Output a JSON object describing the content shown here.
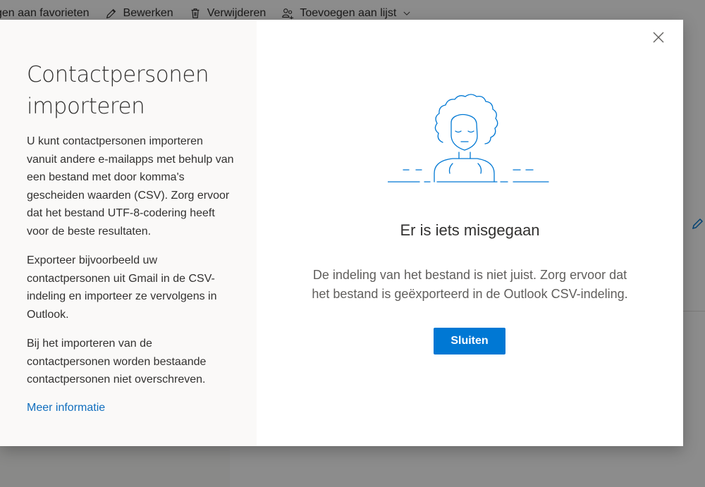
{
  "toolbar": {
    "items": [
      {
        "label": "gen aan favorieten",
        "icon": "star-icon"
      },
      {
        "label": "Bewerken",
        "icon": "pencil-icon"
      },
      {
        "label": "Verwijderen",
        "icon": "trash-icon"
      },
      {
        "label": "Toevoegen aan lijst",
        "icon": "people-list-icon"
      }
    ]
  },
  "dialog": {
    "title_line1": "Contactpersonen",
    "title_line2": "importeren",
    "paragraphs": [
      "U kunt contactpersonen importeren vanuit andere e-mailapps met behulp van een bestand met door komma's gescheiden waarden (CSV). Zorg ervoor dat het bestand UTF-8-codering heeft voor de beste resultaten.",
      "Exporteer bijvoorbeeld uw contactpersonen uit Gmail in de CSV-indeling en importeer ze vervolgens in Outlook.",
      "Bij het importeren van de contactpersonen worden bestaande contactpersonen niet overschreven."
    ],
    "link": "Meer informatie",
    "error_title": "Er is iets misgegaan",
    "error_message_line1": "De indeling van het bestand is niet juist. Zorg ervoor dat",
    "error_message_line2": "het bestand is geëxporteerd in de Outlook CSV-indeling.",
    "close_button": "Sluiten",
    "close_icon": "close-icon"
  },
  "colors": {
    "accent": "#0078d4",
    "illustration": "#0078d4",
    "link": "#106ebe"
  }
}
